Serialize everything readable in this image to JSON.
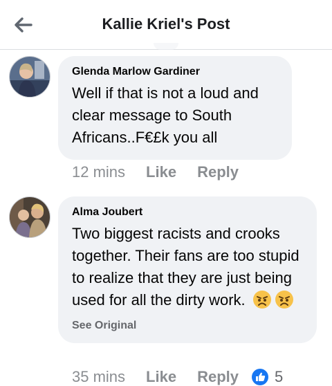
{
  "header": {
    "title": "Kallie Kriel's Post",
    "back_icon": "arrow-left-icon"
  },
  "comments": [
    {
      "author": "Glenda Marlow Gardiner",
      "text": "Well if that is not a loud and clear message to South Africans..F€£k you all",
      "time": "12 mins",
      "like_label": "Like",
      "reply_label": "Reply"
    },
    {
      "author": "Alma Joubert",
      "text": "Two biggest racists and crooks together. Their fans are too stupid to realize that they are just being used for all the dirty work.",
      "emojis": [
        "angry-face-icon",
        "angry-face-icon"
      ],
      "see_original": "See Original",
      "time": "35 mins",
      "like_label": "Like",
      "reply_label": "Reply",
      "reaction_icon": "like-reaction-icon",
      "reaction_count": "5"
    }
  ],
  "colors": {
    "bubble": "#f0f2f5",
    "meta": "#8a8d91",
    "like_blue": "#1877f2",
    "emoji_yellow": "#f7c24a"
  }
}
